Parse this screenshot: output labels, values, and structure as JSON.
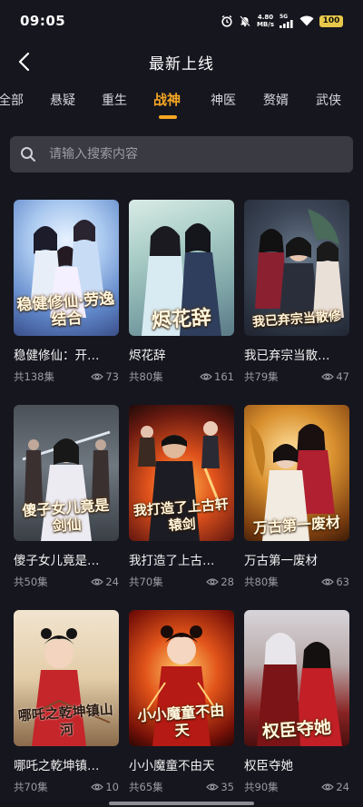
{
  "status_bar": {
    "time": "09:05",
    "net_speed_value": "4.80",
    "net_speed_unit": "MB/s",
    "network": "5G",
    "battery": "100"
  },
  "header": {
    "title": "最新上线"
  },
  "tabs": [
    {
      "label": "全部"
    },
    {
      "label": "悬疑"
    },
    {
      "label": "重生"
    },
    {
      "label": "战神",
      "active": true
    },
    {
      "label": "神医"
    },
    {
      "label": "赘婿"
    },
    {
      "label": "武侠"
    }
  ],
  "search": {
    "placeholder": "请输入搜索内容"
  },
  "items": [
    {
      "title": "稳健修仙：开…",
      "episodes": "共138集",
      "views": "73",
      "poster_text": "稳健修仙·劳逸结合"
    },
    {
      "title": "烬花辞",
      "episodes": "共80集",
      "views": "161",
      "poster_text": "烬花辞"
    },
    {
      "title": "我已弃宗当散…",
      "episodes": "共79集",
      "views": "47",
      "poster_text": "我已弃宗当散修"
    },
    {
      "title": "傻子女儿竟是…",
      "episodes": "共50集",
      "views": "24",
      "poster_text": "傻子女儿竟是剑仙"
    },
    {
      "title": "我打造了上古…",
      "episodes": "共70集",
      "views": "28",
      "poster_text": "我打造了上古轩辕剑"
    },
    {
      "title": "万古第一废材",
      "episodes": "共80集",
      "views": "63",
      "poster_text": "万古第一废材"
    },
    {
      "title": "哪吒之乾坤镇…",
      "episodes": "共70集",
      "views": "10",
      "poster_text": "哪吒之乾坤镇山河"
    },
    {
      "title": "小小魔童不由天",
      "episodes": "共65集",
      "views": "35",
      "poster_text": "小小魔童不由天"
    },
    {
      "title": "权臣夺她",
      "episodes": "共90集",
      "views": "24",
      "poster_text": "权臣夺她"
    }
  ],
  "colors": {
    "background": "#16161f",
    "accent": "#f5a623",
    "search_bg": "#3a3a43",
    "meta_text": "#9a9aa4"
  },
  "icons": {
    "back": "chevron-left-icon",
    "search": "search-icon",
    "views": "eye-icon",
    "alarm": "alarm-icon",
    "mute": "bell-off-icon",
    "signal": "signal-icon",
    "wifi": "wifi-icon"
  }
}
